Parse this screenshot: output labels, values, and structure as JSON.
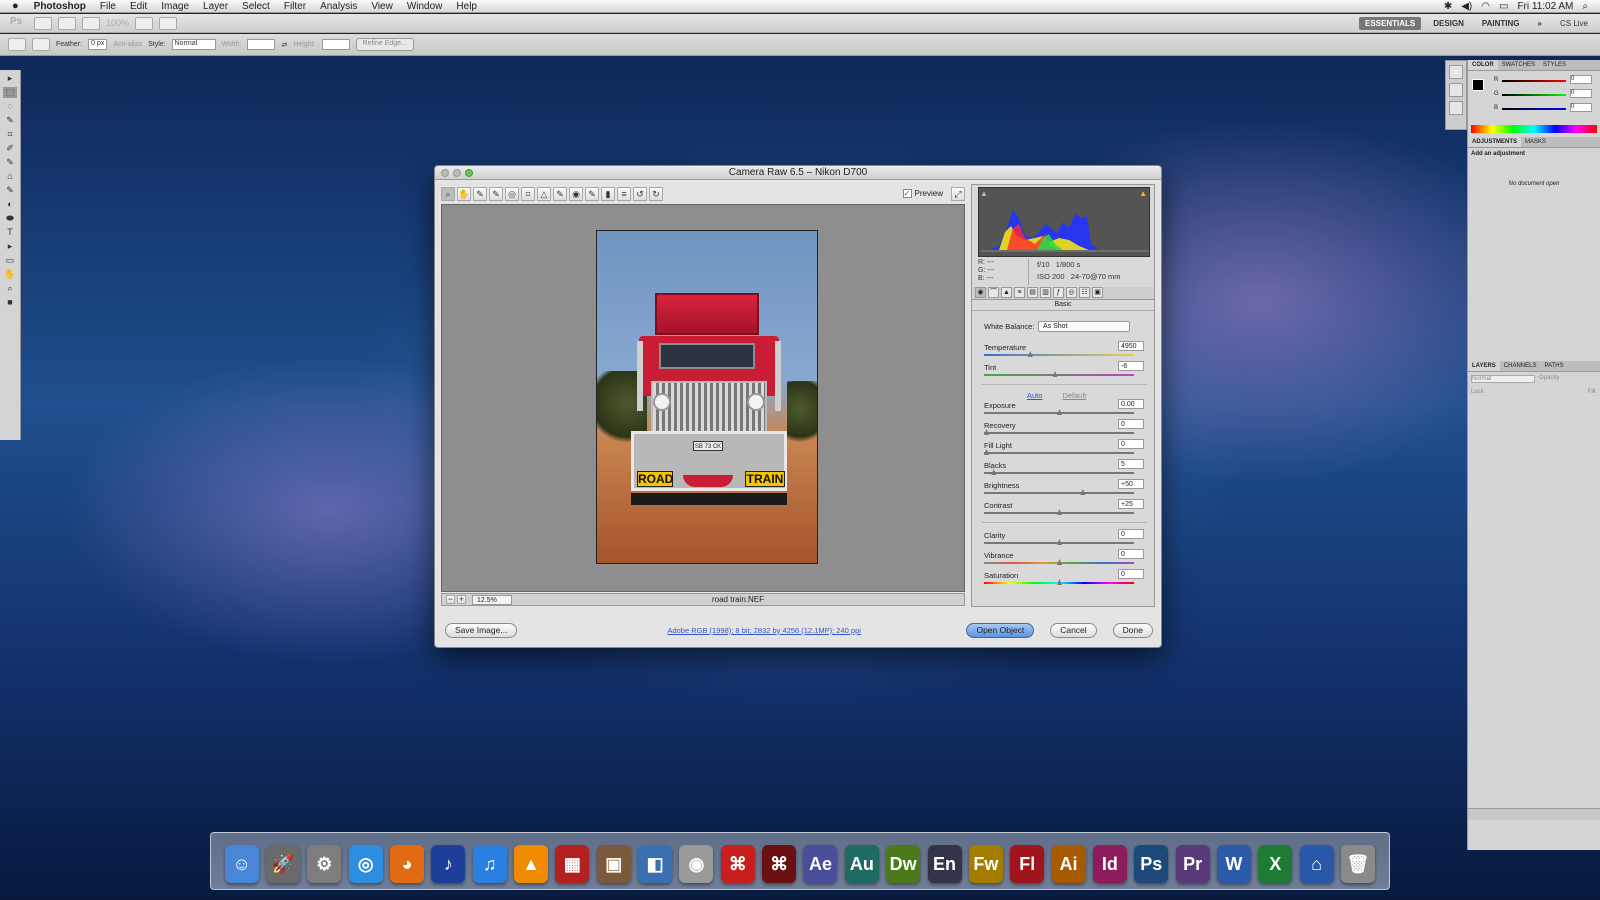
{
  "menubar": {
    "apple": "",
    "app": "Photoshop",
    "items": [
      "File",
      "Edit",
      "Image",
      "Layer",
      "Select",
      "Filter",
      "Analysis",
      "View",
      "Window",
      "Help"
    ],
    "clock": "Fri 11:02 AM"
  },
  "appbar": {
    "logo": "Ps",
    "zoom": "100%",
    "workspaces": [
      "ESSENTIALS",
      "DESIGN",
      "PAINTING"
    ],
    "active_workspace": "ESSENTIALS",
    "more": "»",
    "cslive": "CS Live"
  },
  "options": {
    "feather_label": "Feather:",
    "feather_value": "0 px",
    "antialias": "Anti-alias",
    "style_label": "Style:",
    "style_value": "Normal",
    "width_label": "Width:",
    "height_label": "Height:",
    "refine": "Refine Edge..."
  },
  "tools": [
    "▸",
    "⬚",
    "◌",
    "✎",
    "⌗",
    "✐",
    "✎",
    "⌂",
    "✎",
    "◐",
    "⬬",
    "T",
    "▸",
    "▭",
    "✋",
    "⌕",
    "■"
  ],
  "panels": {
    "color_tabs": [
      "COLOR",
      "SWATCHES",
      "STYLES"
    ],
    "rgb": [
      "R",
      "G",
      "B"
    ],
    "rgb_values": [
      "0",
      "0",
      "0"
    ],
    "adj_tabs": [
      "ADJUSTMENTS",
      "MASKS"
    ],
    "add_adj": "Add an adjustment",
    "no_doc": "No document open",
    "layer_tabs": [
      "LAYERS",
      "CHANNELS",
      "PATHS"
    ],
    "blend": "Normal",
    "opacity": "Opacity:",
    "lock": "Lock:",
    "fill": "Fill:"
  },
  "dialog": {
    "title": "Camera Raw 6.5  –  Nikon D700",
    "preview_label": "Preview",
    "zoom": "12.5%",
    "filename": "road train.NEF",
    "plate_left": "ROAD",
    "plate_right": "TRAIN",
    "plate_reg": "SB 73 CK",
    "exif": {
      "rgb": [
        "R:",
        "G:",
        "B:"
      ],
      "rgb_vals": [
        "---",
        "---",
        "---"
      ],
      "aperture": "f/10",
      "shutter": "1/800 s",
      "iso": "ISO 200",
      "lens": "24-70@70 mm"
    },
    "panel_title": "Basic",
    "wb_label": "White Balance:",
    "wb_value": "As Shot",
    "auto": "Auto",
    "default": "Default",
    "sliders": [
      {
        "label": "Temperature",
        "value": "4950",
        "pos": 0.3
      },
      {
        "label": "Tint",
        "value": "-6",
        "pos": 0.47
      },
      {
        "label": "Exposure",
        "value": "0.00",
        "pos": 0.5
      },
      {
        "label": "Recovery",
        "value": "0",
        "pos": 0.0
      },
      {
        "label": "Fill Light",
        "value": "0",
        "pos": 0.0
      },
      {
        "label": "Blacks",
        "value": "5",
        "pos": 0.05
      },
      {
        "label": "Brightness",
        "value": "+50",
        "pos": 0.66
      },
      {
        "label": "Contrast",
        "value": "+25",
        "pos": 0.5
      },
      {
        "label": "Clarity",
        "value": "0",
        "pos": 0.5
      },
      {
        "label": "Vibrance",
        "value": "0",
        "pos": 0.5
      },
      {
        "label": "Saturation",
        "value": "0",
        "pos": 0.5
      }
    ],
    "save_btn": "Save Image...",
    "info_link": "Adobe RGB (1998); 8 bit; 2832 by 4256 (12.1MP); 240 ppi",
    "open_btn": "Open Object",
    "cancel_btn": "Cancel",
    "done_btn": "Done"
  },
  "dock": [
    {
      "name": "finder",
      "label": "☺",
      "color": "#4a86d8"
    },
    {
      "name": "launchpad",
      "label": "🚀",
      "color": "#6a6a6a"
    },
    {
      "name": "system-preferences",
      "label": "⚙",
      "color": "#7d7d7d"
    },
    {
      "name": "safari",
      "label": "◎",
      "color": "#2d8de0"
    },
    {
      "name": "firefox",
      "label": "◕",
      "color": "#e26a12"
    },
    {
      "name": "audio",
      "label": "♪",
      "color": "#1d3f9a"
    },
    {
      "name": "itunes",
      "label": "♫",
      "color": "#2a7fe0"
    },
    {
      "name": "vlc",
      "label": "▲",
      "color": "#f08a00"
    },
    {
      "name": "photo-booth",
      "label": "▦",
      "color": "#b32020"
    },
    {
      "name": "iphoto",
      "label": "▣",
      "color": "#7a5a3a"
    },
    {
      "name": "preview",
      "label": "◧",
      "color": "#3a6fb0"
    },
    {
      "name": "dvd-player",
      "label": "◉",
      "color": "#9a9a9a"
    },
    {
      "name": "acrobat",
      "label": "⌘",
      "color": "#c81e1e"
    },
    {
      "name": "acrobat-pro",
      "label": "⌘",
      "color": "#6a1010"
    },
    {
      "name": "after-effects",
      "label": "Ae",
      "color": "#4a4e9a"
    },
    {
      "name": "audition",
      "label": "Au",
      "color": "#1f6a62"
    },
    {
      "name": "dreamweaver",
      "label": "Dw",
      "color": "#4a7a1a"
    },
    {
      "name": "encore",
      "label": "En",
      "color": "#33344a"
    },
    {
      "name": "fireworks",
      "label": "Fw",
      "color": "#a37c00"
    },
    {
      "name": "flash",
      "label": "Fl",
      "color": "#a0141b"
    },
    {
      "name": "illustrator",
      "label": "Ai",
      "color": "#a85a00"
    },
    {
      "name": "indesign",
      "label": "Id",
      "color": "#8c1c5c"
    },
    {
      "name": "photoshop",
      "label": "Ps",
      "color": "#1d4a7a"
    },
    {
      "name": "premiere",
      "label": "Pr",
      "color": "#5a3a78"
    },
    {
      "name": "word",
      "label": "W",
      "color": "#2b5aa8"
    },
    {
      "name": "excel",
      "label": "X",
      "color": "#1f7a34"
    },
    {
      "name": "home",
      "label": "⌂",
      "color": "#2a58a8"
    },
    {
      "name": "trash",
      "label": "🗑",
      "color": "#8a8a8a"
    }
  ]
}
